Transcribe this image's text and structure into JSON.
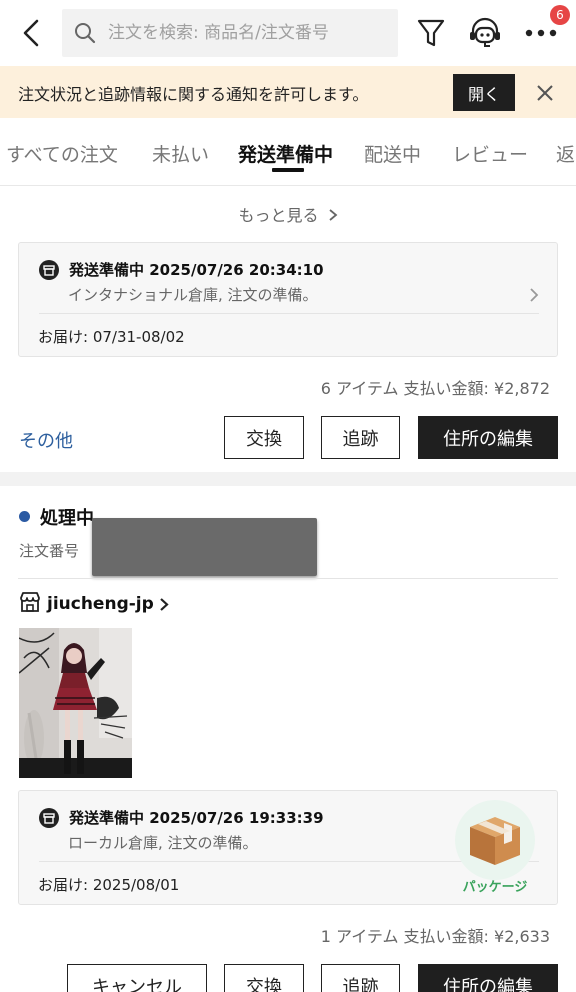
{
  "header": {
    "search_placeholder": "注文を検索: 商品名/注文番号",
    "notification_badge": "6"
  },
  "notice": {
    "text": "注文状況と追跡情報に関する通知を許可します。",
    "open_label": "開く"
  },
  "tabs": [
    {
      "label": "すべての注文"
    },
    {
      "label": "未払い"
    },
    {
      "label": "発送準備中"
    },
    {
      "label": "配送中"
    },
    {
      "label": "レビュー"
    },
    {
      "label": "返"
    }
  ],
  "order1": {
    "more_label": "もっと見る",
    "status_title": "発送準備中 2025/07/26 20:34:10",
    "status_sub": "インタナショナル倉庫, 注文の準備。",
    "delivery": "お届け: 07/31-08/02",
    "total": "6 アイテム 支払い金額: ¥2,872",
    "other_label": "その他",
    "buttons": {
      "exchange": "交換",
      "track": "追跡",
      "edit_address": "住所の編集"
    }
  },
  "order2": {
    "state": "処理中",
    "order_number_label": "注文番号",
    "shop": "jiucheng-jp",
    "status_title": "発送準備中 2025/07/26 19:33:39",
    "status_sub": "ローカル倉庫, 注文の準備。",
    "delivery": "お届け: 2025/08/01",
    "package_label": "パッケージ",
    "total": "1 アイテム 支払い金額: ¥2,633",
    "buttons": {
      "cancel": "キャンセル",
      "exchange": "交換",
      "track": "追跡",
      "edit_address": "住所の編集"
    }
  },
  "colors": {
    "accent_dark": "#1f1f1f",
    "link": "#2d5f9e",
    "notice_bg": "#fdf0dc",
    "badge": "#e64545",
    "package_green": "#3aa35c"
  }
}
